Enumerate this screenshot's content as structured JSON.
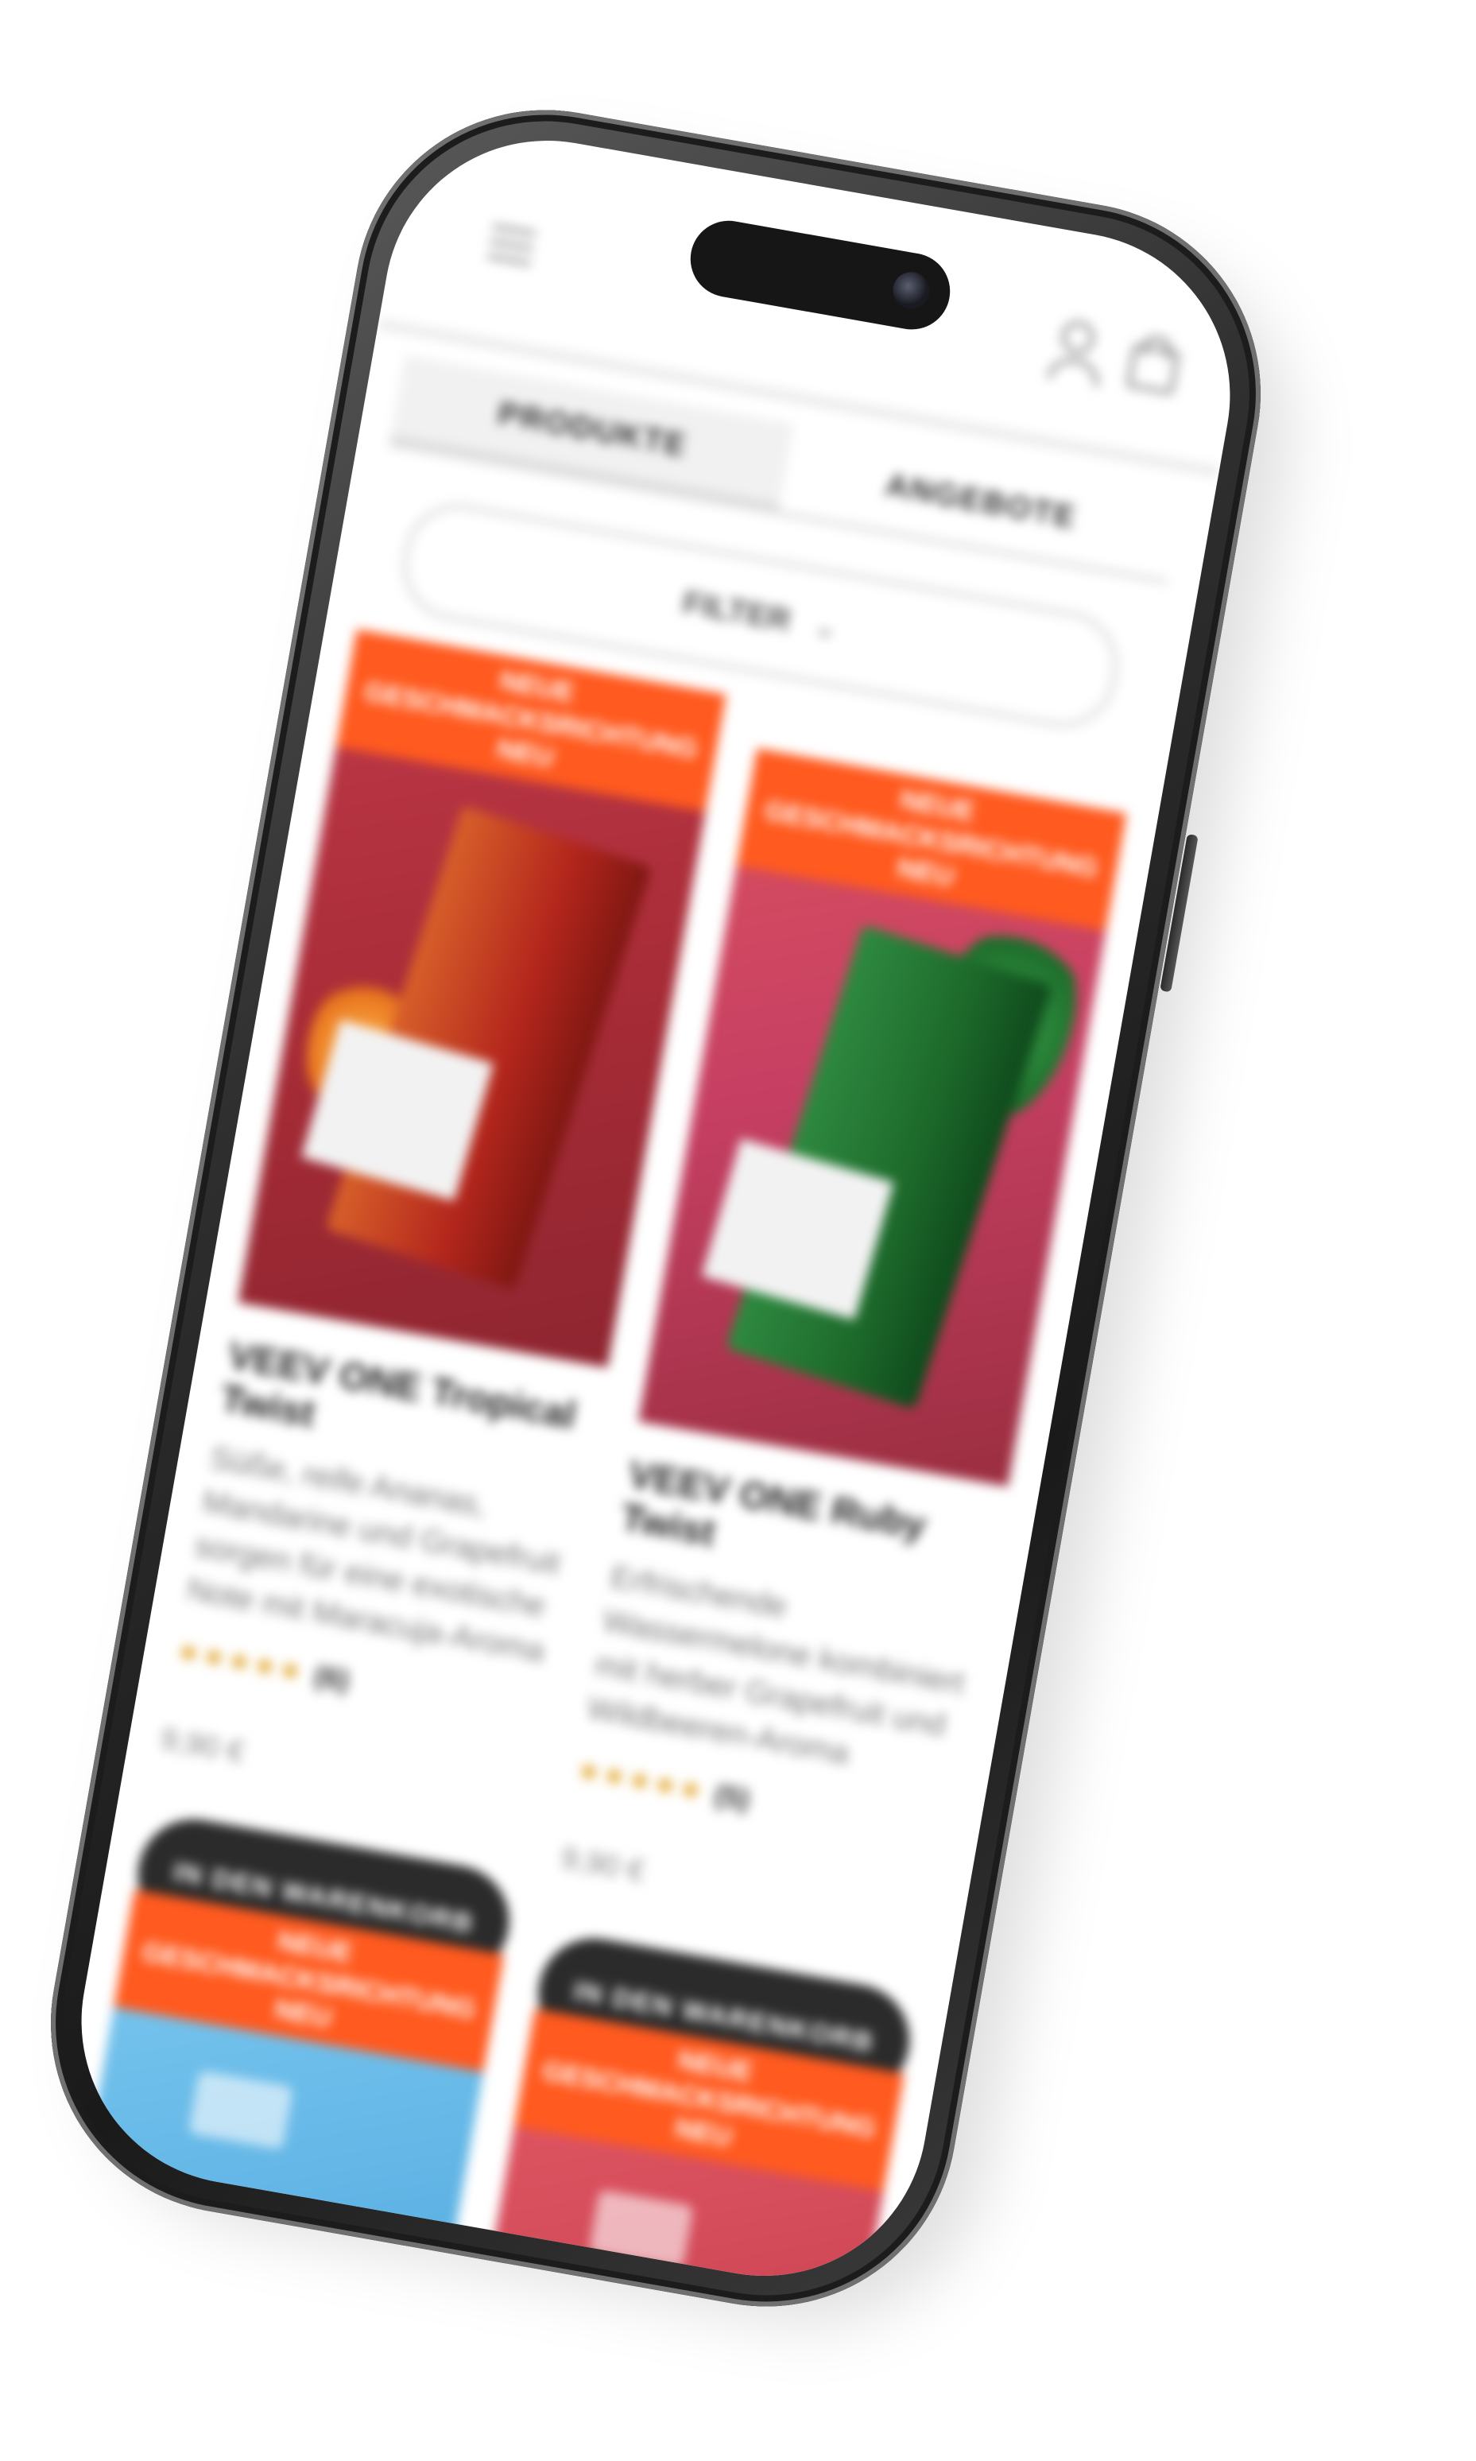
{
  "header": {
    "menu_icon": "hamburger-icon",
    "account_icon": "user-icon",
    "cart_icon": "cart-icon"
  },
  "tabs": [
    {
      "label": "PRODUKTE",
      "active": true
    },
    {
      "label": "ANGEBOTE",
      "active": false
    }
  ],
  "filter": {
    "label": "FILTER",
    "icon": "chevron-down-icon"
  },
  "products": [
    {
      "badge_line1": "NEUE GESCHMACKSRICHTUNG",
      "badge_line2": "NEU",
      "title": "VEEV ONE Tropical Twist",
      "description": "Süße, reife Ananas, Mandarine und Grapefruit sorgen für eine exotische Note mit Maracuja-Aroma",
      "rating_count": "(6)",
      "price": "9,90 €",
      "cta_label": "IN DEN WARENKORB",
      "image_colors": {
        "bg": "#c0394a",
        "pack": "#d8602a"
      }
    },
    {
      "badge_line1": "NEUE GESCHMACKSRICHTUNG",
      "badge_line2": "NEU",
      "title": "VEEV ONE Ruby Twist",
      "description": "Erfrischende Wassermelone kombiniert mit herber Grapefruit und Wildbeeren-Aroma",
      "rating_count": "(5)",
      "price": "9,90 €",
      "cta_label": "IN DEN WARENKORB",
      "image_colors": {
        "bg": "#d9505e",
        "pack": "#2f8a40"
      }
    }
  ],
  "more_products": [
    {
      "badge_line1": "NEUE GESCHMACKSRICHTUNG",
      "badge_line2": "NEU",
      "image_color": "#6fc0ec"
    },
    {
      "badge_line1": "NEUE GESCHMACKSRICHTUNG",
      "badge_line2": "NEU",
      "image_color": "#d9505e"
    }
  ],
  "colors": {
    "accent": "#ff5a1f",
    "button": "#2b2b2b",
    "stars": "#e0a020",
    "phone_frame": "#2f2f2f"
  }
}
